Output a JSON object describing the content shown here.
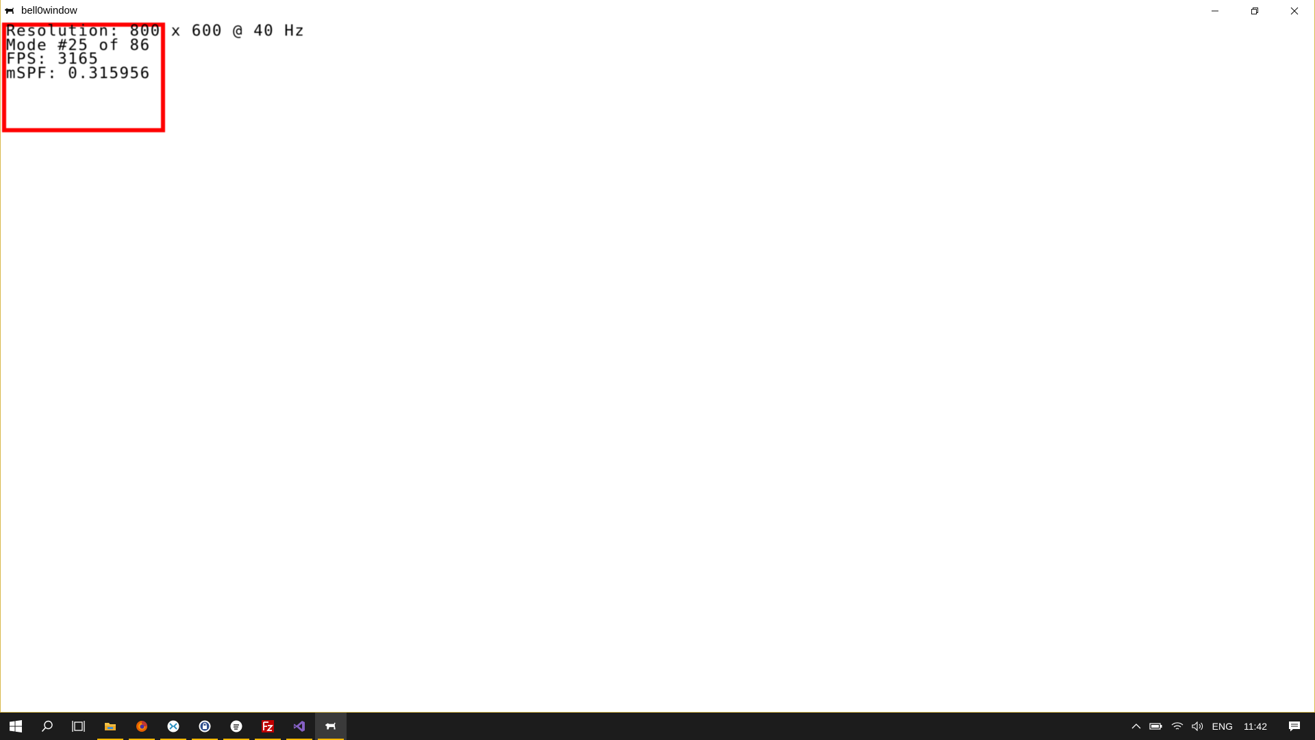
{
  "window": {
    "title": "bell0window",
    "icon": "dog-icon"
  },
  "caption_buttons": {
    "minimize_icon": "minimize-icon",
    "restore_icon": "restore-icon",
    "close_icon": "close-icon"
  },
  "overlay": {
    "line1": "Resolution: 800 x 600 @ 40 Hz",
    "line2": "Mode #25 of 86",
    "line3": "FPS: 3165",
    "line4": "mSPF: 0.315956",
    "rect_color": "#ff0000"
  },
  "taskbar": {
    "apps": [
      {
        "name": "start-button",
        "icon": "windows-logo-icon"
      },
      {
        "name": "search-button",
        "icon": "search-icon"
      },
      {
        "name": "task-view-button",
        "icon": "task-view-icon"
      },
      {
        "name": "file-explorer-button",
        "icon": "folder-icon"
      },
      {
        "name": "firefox-button",
        "icon": "firefox-icon"
      },
      {
        "name": "app-x-button",
        "icon": "x-app-icon"
      },
      {
        "name": "app-lock-button",
        "icon": "lock-app-icon"
      },
      {
        "name": "app-dialog-button",
        "icon": "dialog-app-icon"
      },
      {
        "name": "filezilla-button",
        "icon": "filezilla-icon"
      },
      {
        "name": "visual-studio-button",
        "icon": "visual-studio-icon"
      },
      {
        "name": "bell0window-button",
        "icon": "dog-icon"
      }
    ],
    "tray": {
      "chevron_icon": "chevron-up-icon",
      "battery_icon": "battery-icon",
      "wifi_icon": "wifi-icon",
      "volume_icon": "volume-icon",
      "language": "ENG",
      "time": "11:42",
      "notification_icon": "notification-icon"
    },
    "accent_color": "#ffb900",
    "background_color": "#1c1c1c"
  }
}
